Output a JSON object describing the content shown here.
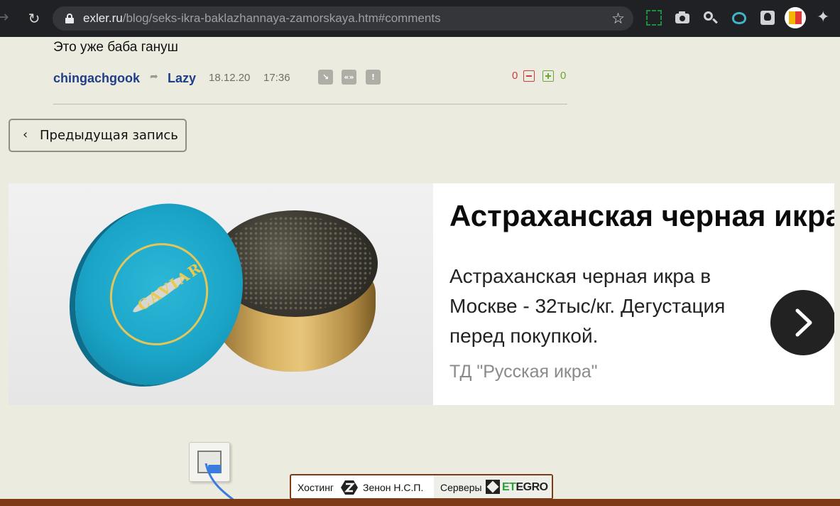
{
  "browser": {
    "url_host": "exler.ru",
    "url_path": "/blog/seks-ikra-baklazhannaya-zamorskaya.htm#comments"
  },
  "comment": {
    "text": "Это уже баба гануш",
    "author": "chingachgook",
    "reply_to": "Lazy",
    "date": "18.12.20",
    "time": "17:36",
    "score_minus": "0",
    "score_plus": "0"
  },
  "nav": {
    "prev_label": "Предыдущая запись"
  },
  "ad": {
    "title": "Астраханская черная икра",
    "description": "Астраханская черная икра в Москве - 32тыс/кг. Дегустация перед покупкой.",
    "brand": "ТД \"Русская икра\"",
    "lid_text": "CAVIAR"
  },
  "footer": {
    "hosting_label": "Хостинг",
    "hosting_provider": "Зенон Н.С.П.",
    "servers_label": "Серверы",
    "servers_provider_a": "ET",
    "servers_provider_b": "EGRO"
  },
  "colors": {
    "page_bg": "#ecebdf",
    "link": "#1f3e88",
    "minus": "#d23c3c",
    "plus": "#6aa737",
    "footer_accent": "#7e3a16"
  }
}
